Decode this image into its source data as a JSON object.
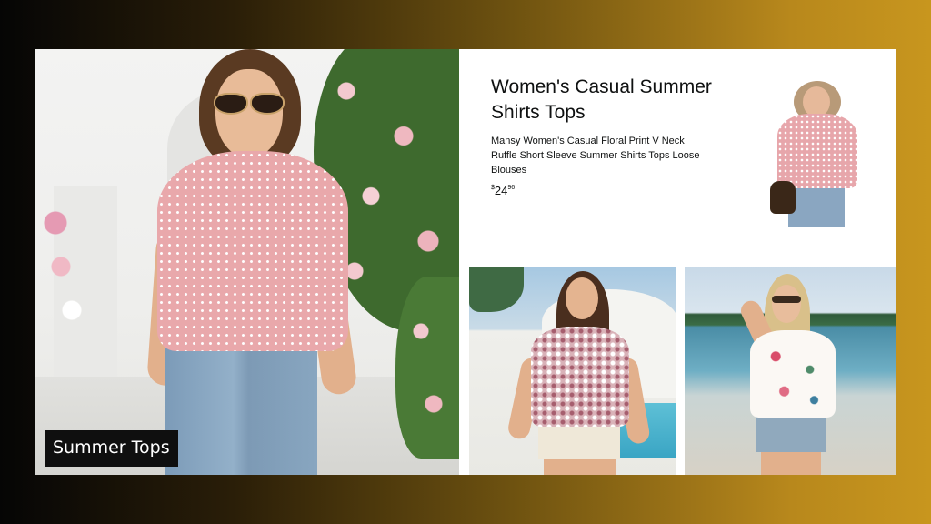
{
  "hero": {
    "label": "Summer Tops"
  },
  "product": {
    "title": "Women's Casual Summer Shirts Tops",
    "description": "Mansy Women's Casual Floral Print V Neck Ruffle Short Sleeve Summer Shirts Tops Loose Blouses",
    "price": {
      "symbol": "$",
      "whole": "24",
      "fraction": "96"
    }
  },
  "colors": {
    "background_start": "#050505",
    "background_end": "#c8961e",
    "card": "#ffffff",
    "label_bg": "#0f0f0f",
    "text": "#0f1111"
  }
}
